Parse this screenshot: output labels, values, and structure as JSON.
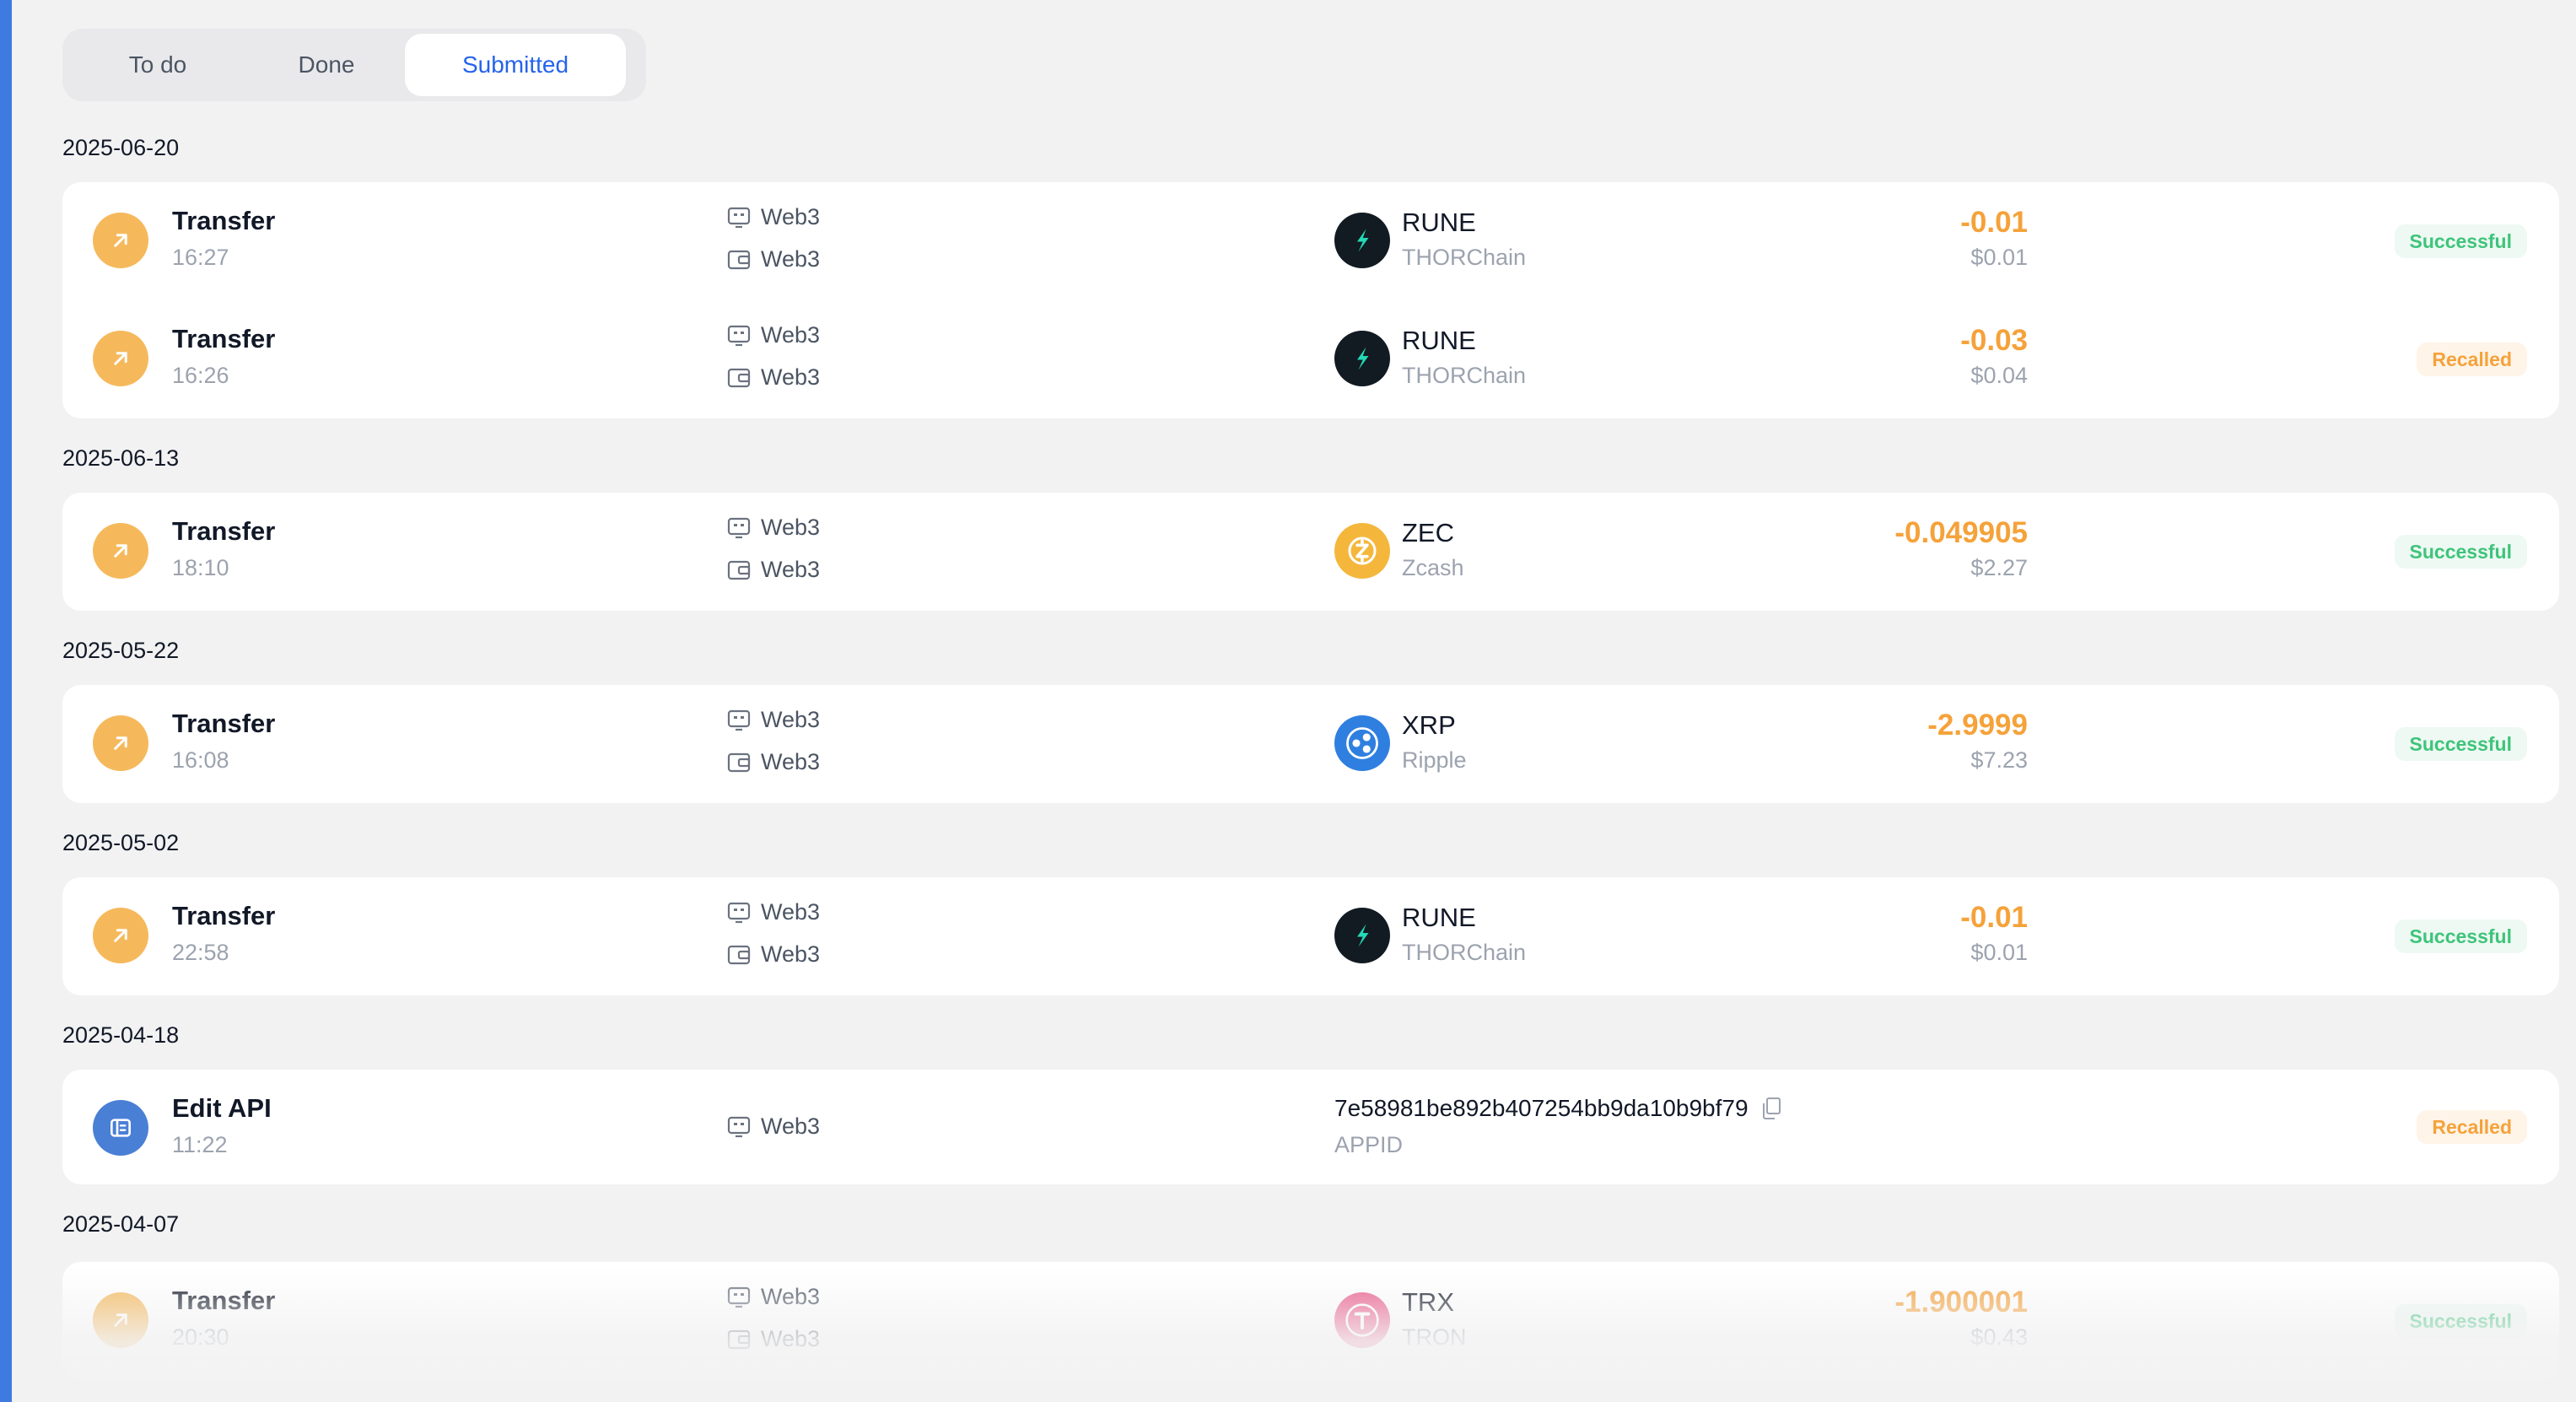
{
  "tabs": [
    {
      "label": "To do",
      "active": false
    },
    {
      "label": "Done",
      "active": false
    },
    {
      "label": "Submitted",
      "active": true
    }
  ],
  "colors": {
    "accent": "#2563eb",
    "amount": "#f5a23a",
    "success": "#3ec47a",
    "recalled": "#f5a23a",
    "sidebar": "#3f7ae0"
  },
  "groups": [
    {
      "date": "2025-06-20",
      "rows": [
        {
          "action": "Transfer",
          "time": "16:27",
          "icon": "arrow-up-right-icon",
          "sources": [
            "Web3",
            "Web3"
          ],
          "asset_symbol": "RUNE",
          "asset_name": "THORChain",
          "asset_icon": "thorchain-logo",
          "amount": "-0.01",
          "usd": "$0.01",
          "status": "Successful"
        },
        {
          "action": "Transfer",
          "time": "16:26",
          "icon": "arrow-up-right-icon",
          "sources": [
            "Web3",
            "Web3"
          ],
          "asset_symbol": "RUNE",
          "asset_name": "THORChain",
          "asset_icon": "thorchain-logo",
          "amount": "-0.03",
          "usd": "$0.04",
          "status": "Recalled"
        }
      ]
    },
    {
      "date": "2025-06-13",
      "rows": [
        {
          "action": "Transfer",
          "time": "18:10",
          "icon": "arrow-up-right-icon",
          "sources": [
            "Web3",
            "Web3"
          ],
          "asset_symbol": "ZEC",
          "asset_name": "Zcash",
          "asset_icon": "zcash-logo",
          "amount": "-0.049905",
          "usd": "$2.27",
          "status": "Successful"
        }
      ]
    },
    {
      "date": "2025-05-22",
      "rows": [
        {
          "action": "Transfer",
          "time": "16:08",
          "icon": "arrow-up-right-icon",
          "sources": [
            "Web3",
            "Web3"
          ],
          "asset_symbol": "XRP",
          "asset_name": "Ripple",
          "asset_icon": "ripple-logo",
          "amount": "-2.9999",
          "usd": "$7.23",
          "status": "Successful"
        }
      ]
    },
    {
      "date": "2025-05-02",
      "rows": [
        {
          "action": "Transfer",
          "time": "22:58",
          "icon": "arrow-up-right-icon",
          "sources": [
            "Web3",
            "Web3"
          ],
          "asset_symbol": "RUNE",
          "asset_name": "THORChain",
          "asset_icon": "thorchain-logo",
          "amount": "-0.01",
          "usd": "$0.01",
          "status": "Successful"
        }
      ]
    },
    {
      "date": "2025-04-18",
      "rows": [
        {
          "action": "Edit API",
          "time": "11:22",
          "icon": "api-icon",
          "sources": [
            "Web3"
          ],
          "hash": "7e58981be892b407254bb9da10b9bf79",
          "hash_label": "APPID",
          "status": "Recalled"
        }
      ]
    },
    {
      "date": "2025-04-07",
      "rows": [
        {
          "action": "Transfer",
          "time": "20:30",
          "icon": "arrow-up-right-icon",
          "sources": [
            "Web3",
            "Web3"
          ],
          "asset_symbol": "TRX",
          "asset_name": "TRON",
          "asset_icon": "tron-logo",
          "amount": "-1.900001",
          "usd": "$0.43",
          "status": "Successful"
        }
      ]
    }
  ]
}
